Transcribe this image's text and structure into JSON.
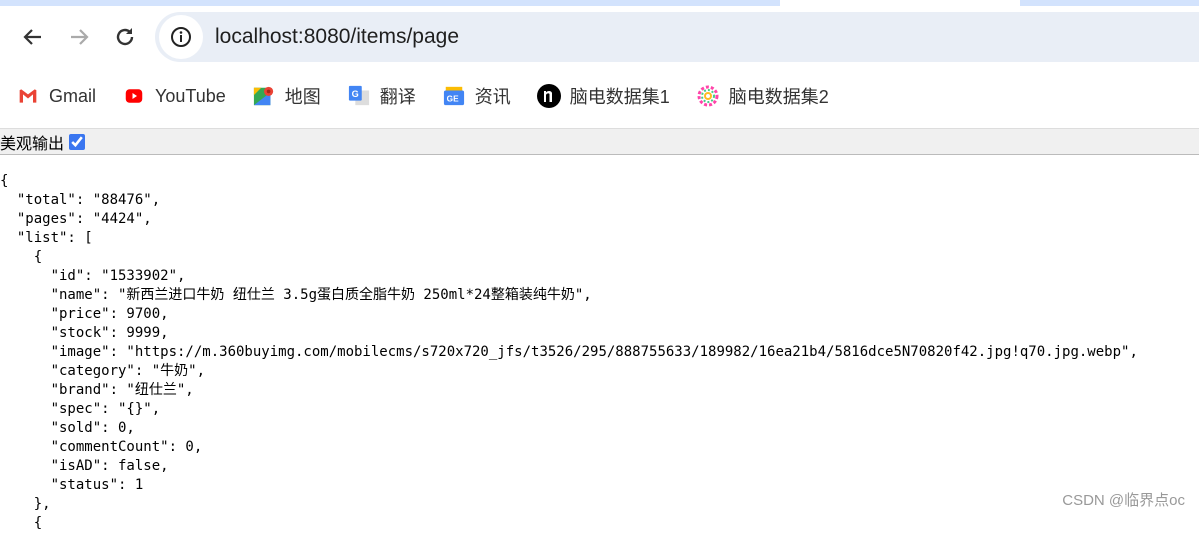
{
  "browser": {
    "url": "localhost:8080/items/page",
    "bookmarks": [
      {
        "label": "Gmail",
        "icon": "gmail-icon"
      },
      {
        "label": "YouTube",
        "icon": "youtube-icon"
      },
      {
        "label": "地图",
        "icon": "maps-icon"
      },
      {
        "label": "翻译",
        "icon": "translate-icon"
      },
      {
        "label": "资讯",
        "icon": "news-icon"
      },
      {
        "label": "脑电数据集1",
        "icon": "n-logo-icon"
      },
      {
        "label": "脑电数据集2",
        "icon": "colorful-ring-icon"
      }
    ]
  },
  "pretty_print": {
    "label": "美观输出",
    "checked": true
  },
  "json_lines": [
    "{",
    "  \"total\": \"88476\",",
    "  \"pages\": \"4424\",",
    "  \"list\": [",
    "    {",
    "      \"id\": \"1533902\",",
    "      \"name\": \"新西兰进口牛奶 纽仕兰 3.5g蛋白质全脂牛奶 250ml*24整箱装纯牛奶\",",
    "      \"price\": 9700,",
    "      \"stock\": 9999,",
    "      \"image\": \"https://m.360buyimg.com/mobilecms/s720x720_jfs/t3526/295/888755633/189982/16ea21b4/5816dce5N70820f42.jpg!q70.jpg.webp\",",
    "      \"category\": \"牛奶\",",
    "      \"brand\": \"纽仕兰\",",
    "      \"spec\": \"{}\",",
    "      \"sold\": 0,",
    "      \"commentCount\": 0,",
    "      \"isAD\": false,",
    "      \"status\": 1",
    "    },",
    "    {"
  ],
  "watermark": "CSDN @临界点oc"
}
